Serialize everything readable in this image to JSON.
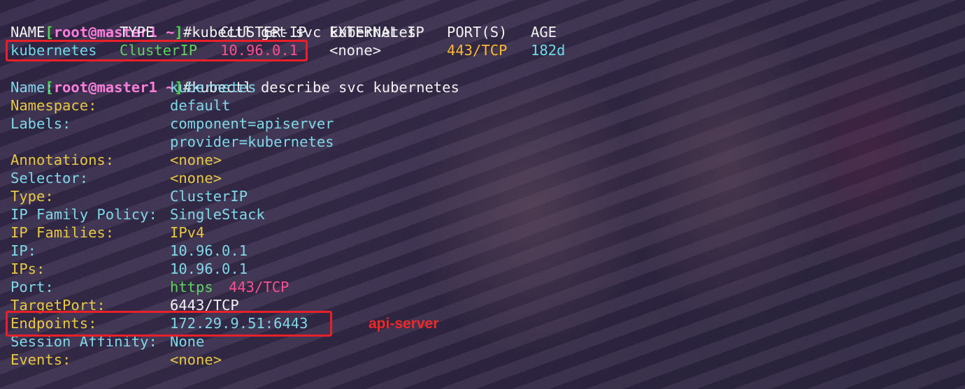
{
  "prompt": {
    "open": "[",
    "user": "root",
    "at": "@",
    "host": "master1",
    "dir": " ~",
    "close": "]",
    "hash": "#"
  },
  "commands": {
    "get": "kubectl get svc kubernetes",
    "describe": "kubectl describe svc kubernetes"
  },
  "table": {
    "headers": {
      "name": "NAME",
      "type": "TYPE",
      "cluster_ip": "CLUSTER-IP",
      "external_ip": "EXTERNAL-IP",
      "ports": "PORT(S)",
      "age": "AGE"
    },
    "row": {
      "name": "kubernetes",
      "type": "ClusterIP",
      "cluster_ip": "10.96.0.1",
      "external_ip": "<none>",
      "ports": "443/TCP",
      "age": "182d"
    }
  },
  "describe": {
    "name": {
      "key": "Name:",
      "value": "kubernetes"
    },
    "namespace": {
      "key": "Namespace:",
      "value": "default"
    },
    "labels": {
      "key": "Labels:",
      "value": "component=apiserver",
      "value2": "provider=kubernetes"
    },
    "annotations": {
      "key": "Annotations:",
      "value": "<none>"
    },
    "selector": {
      "key": "Selector:",
      "value": "<none>"
    },
    "type": {
      "key": "Type:",
      "value": "ClusterIP"
    },
    "ip_family_policy": {
      "key": "IP Family Policy:",
      "value": "SingleStack"
    },
    "ip_families": {
      "key": "IP Families:",
      "value": "IPv4"
    },
    "ip": {
      "key": "IP:",
      "value": "10.96.0.1"
    },
    "ips": {
      "key": "IPs:",
      "value": "10.96.0.1"
    },
    "port": {
      "key": "Port:",
      "value_name": "https",
      "value_port": "443/TCP"
    },
    "target_port": {
      "key": "TargetPort:",
      "value": "6443/TCP"
    },
    "endpoints": {
      "key": "Endpoints:",
      "value": "172.29.9.51:6443"
    },
    "session_affinity": {
      "key": "Session Affinity:",
      "value": "None"
    },
    "events": {
      "key": "Events:",
      "value": "<none>"
    }
  },
  "annotation_text": "api-server",
  "colors": {
    "highlight": "#e8202a",
    "prompt_bracket": "#4fd64f",
    "prompt_user": "#ff7edb",
    "key": "#e8c840",
    "value": "#7fd8e8",
    "cluster_ip": "#ff4f8f",
    "port": "#ffb833",
    "type": "#5fd35f"
  }
}
